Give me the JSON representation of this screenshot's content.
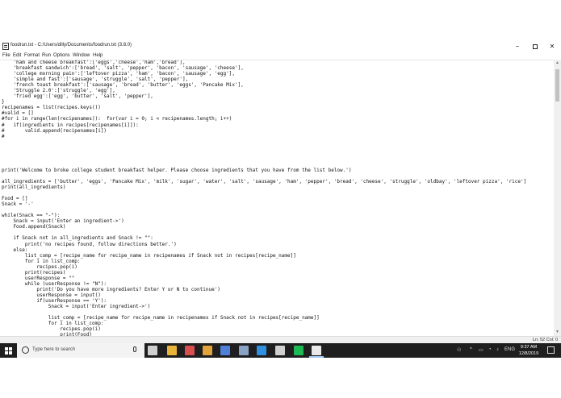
{
  "window": {
    "title": "foodrun.txt - C:/Users/dilly/Documents/foodrun.txt (3.8.0)",
    "controls": {
      "minimize": "−",
      "close": "✕"
    }
  },
  "menu": [
    "File",
    "Edit",
    "Format",
    "Run",
    "Options",
    "Window",
    "Help"
  ],
  "editor": {
    "code": "    'ham and cheese breakfast':['eggs','cheese','ham','bread'],\n    'breakfast sandwich':['bread', 'salt', 'pepper', 'bacon', 'sausage', 'cheese'],\n    'college morning pain':['leftover pizza', 'ham', 'bacon', 'sausage', 'egg'],\n    'simple and fast':['sausage', 'struggle', 'salt', 'pepper'],\n    'french toast breakfast':['sausage', 'bread', 'butter', 'eggs', 'Pancake Mix'],\n    'Struggle 2.0':['struggle', 'egg'],\n    'fried egg':['egg', 'butter', 'salt', 'pepper'],\n}\nrecipenames = list(recipes.keys())\n#valid = []\n#for i in range(len(recipenames)):  for(var i = 0; i < recipenames.length; i++)\n#   if(ingredients in recipes[recipenames[i]]):\n#       valid.append(recipenames[i])\n#\n\n\n\n\n\nprint('Welcome to broke college student breakfast helper. Please choose ingredients that you have from the list below.')\n\nall_ingredients = ['butter', 'eggs', 'Pancake Mix', 'milk', 'sugar', 'water', 'salt', 'sausage', 'ham', 'pepper', 'bread', 'cheese', 'struggle', 'oldbay', 'leftover pizza', 'rice']\nprint(all_ingredients)\n\nFood = []\nSnack = '-'\n\nwhile(Snack == \"-\"):\n    Snack = input('Enter an ingredient->')\n    Food.append(Snack)\n\n    if Snack not in all_ingredients and Snack != \"\":\n        print('no recipes found, follow directions better.')\n    else:\n        list_comp = [recipe_name for recipe_name in recipenames if Snack not in recipes[recipe_name]]\n        for i in list_comp:\n            recipes.pop(i)\n        print(recipes)\n        userResponse = \"\"\n        while (userResponse != \"N\"):\n            print('Do you have more ingredients? Enter Y or N to continue')\n            userResponse = input()\n            if(userResponse == 'Y'):\n                Snack = input('Enter ingredient->')\n\n                list_comp = [recipe_name for recipe_name in recipenames if Snack not in recipes[recipe_name]]\n                for i in list_comp:\n                    recipes.pop(i)\n                    print(Food)\n"
  },
  "status": {
    "position": "Ln: 52  Col: 0"
  },
  "taskbar": {
    "search_placeholder": "Type here to search",
    "apps": [
      {
        "icon": "task-view-icon",
        "color": "#cfcfcf"
      },
      {
        "icon": "file-explorer-icon",
        "color": "#e8b43a"
      },
      {
        "icon": "snipping-tool-icon",
        "color": "#d94f4f"
      },
      {
        "icon": "chrome-icon",
        "color": "#e0a43a"
      },
      {
        "icon": "store-icon",
        "color": "#4f7fd6"
      },
      {
        "icon": "steam-icon",
        "color": "#8aa3c4"
      },
      {
        "icon": "vscode-icon",
        "color": "#2f8fe0"
      },
      {
        "icon": "discord-icon",
        "color": "#d0d0d0"
      },
      {
        "icon": "spotify-icon",
        "color": "#1db954"
      },
      {
        "icon": "idle-icon",
        "color": "#e8e8e8"
      }
    ],
    "tray_lang": "ENG",
    "time": "9:37 AM",
    "date": "12/8/2019"
  }
}
